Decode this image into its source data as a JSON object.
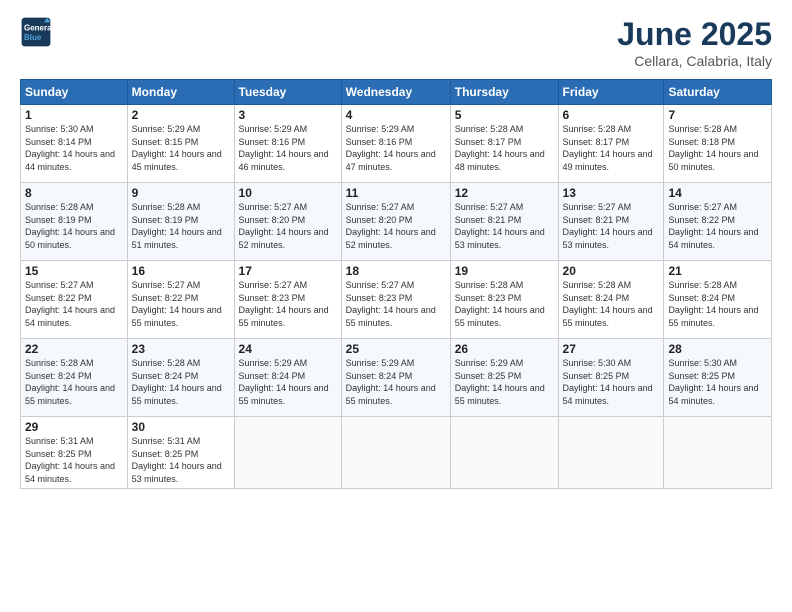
{
  "logo": {
    "line1": "General",
    "line2": "Blue"
  },
  "title": "June 2025",
  "subtitle": "Cellara, Calabria, Italy",
  "days_header": [
    "Sunday",
    "Monday",
    "Tuesday",
    "Wednesday",
    "Thursday",
    "Friday",
    "Saturday"
  ],
  "weeks": [
    [
      {
        "day": "1",
        "sunrise": "5:30 AM",
        "sunset": "8:14 PM",
        "daylight": "14 hours and 44 minutes."
      },
      {
        "day": "2",
        "sunrise": "5:29 AM",
        "sunset": "8:15 PM",
        "daylight": "14 hours and 45 minutes."
      },
      {
        "day": "3",
        "sunrise": "5:29 AM",
        "sunset": "8:16 PM",
        "daylight": "14 hours and 46 minutes."
      },
      {
        "day": "4",
        "sunrise": "5:29 AM",
        "sunset": "8:16 PM",
        "daylight": "14 hours and 47 minutes."
      },
      {
        "day": "5",
        "sunrise": "5:28 AM",
        "sunset": "8:17 PM",
        "daylight": "14 hours and 48 minutes."
      },
      {
        "day": "6",
        "sunrise": "5:28 AM",
        "sunset": "8:17 PM",
        "daylight": "14 hours and 49 minutes."
      },
      {
        "day": "7",
        "sunrise": "5:28 AM",
        "sunset": "8:18 PM",
        "daylight": "14 hours and 50 minutes."
      }
    ],
    [
      {
        "day": "8",
        "sunrise": "5:28 AM",
        "sunset": "8:19 PM",
        "daylight": "14 hours and 50 minutes."
      },
      {
        "day": "9",
        "sunrise": "5:28 AM",
        "sunset": "8:19 PM",
        "daylight": "14 hours and 51 minutes."
      },
      {
        "day": "10",
        "sunrise": "5:27 AM",
        "sunset": "8:20 PM",
        "daylight": "14 hours and 52 minutes."
      },
      {
        "day": "11",
        "sunrise": "5:27 AM",
        "sunset": "8:20 PM",
        "daylight": "14 hours and 52 minutes."
      },
      {
        "day": "12",
        "sunrise": "5:27 AM",
        "sunset": "8:21 PM",
        "daylight": "14 hours and 53 minutes."
      },
      {
        "day": "13",
        "sunrise": "5:27 AM",
        "sunset": "8:21 PM",
        "daylight": "14 hours and 53 minutes."
      },
      {
        "day": "14",
        "sunrise": "5:27 AM",
        "sunset": "8:22 PM",
        "daylight": "14 hours and 54 minutes."
      }
    ],
    [
      {
        "day": "15",
        "sunrise": "5:27 AM",
        "sunset": "8:22 PM",
        "daylight": "14 hours and 54 minutes."
      },
      {
        "day": "16",
        "sunrise": "5:27 AM",
        "sunset": "8:22 PM",
        "daylight": "14 hours and 55 minutes."
      },
      {
        "day": "17",
        "sunrise": "5:27 AM",
        "sunset": "8:23 PM",
        "daylight": "14 hours and 55 minutes."
      },
      {
        "day": "18",
        "sunrise": "5:27 AM",
        "sunset": "8:23 PM",
        "daylight": "14 hours and 55 minutes."
      },
      {
        "day": "19",
        "sunrise": "5:28 AM",
        "sunset": "8:23 PM",
        "daylight": "14 hours and 55 minutes."
      },
      {
        "day": "20",
        "sunrise": "5:28 AM",
        "sunset": "8:24 PM",
        "daylight": "14 hours and 55 minutes."
      },
      {
        "day": "21",
        "sunrise": "5:28 AM",
        "sunset": "8:24 PM",
        "daylight": "14 hours and 55 minutes."
      }
    ],
    [
      {
        "day": "22",
        "sunrise": "5:28 AM",
        "sunset": "8:24 PM",
        "daylight": "14 hours and 55 minutes."
      },
      {
        "day": "23",
        "sunrise": "5:28 AM",
        "sunset": "8:24 PM",
        "daylight": "14 hours and 55 minutes."
      },
      {
        "day": "24",
        "sunrise": "5:29 AM",
        "sunset": "8:24 PM",
        "daylight": "14 hours and 55 minutes."
      },
      {
        "day": "25",
        "sunrise": "5:29 AM",
        "sunset": "8:24 PM",
        "daylight": "14 hours and 55 minutes."
      },
      {
        "day": "26",
        "sunrise": "5:29 AM",
        "sunset": "8:25 PM",
        "daylight": "14 hours and 55 minutes."
      },
      {
        "day": "27",
        "sunrise": "5:30 AM",
        "sunset": "8:25 PM",
        "daylight": "14 hours and 54 minutes."
      },
      {
        "day": "28",
        "sunrise": "5:30 AM",
        "sunset": "8:25 PM",
        "daylight": "14 hours and 54 minutes."
      }
    ],
    [
      {
        "day": "29",
        "sunrise": "5:31 AM",
        "sunset": "8:25 PM",
        "daylight": "14 hours and 54 minutes."
      },
      {
        "day": "30",
        "sunrise": "5:31 AM",
        "sunset": "8:25 PM",
        "daylight": "14 hours and 53 minutes."
      },
      null,
      null,
      null,
      null,
      null
    ]
  ]
}
